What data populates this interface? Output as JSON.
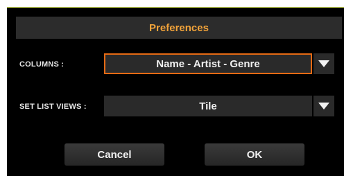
{
  "dialog": {
    "title": "Preferences"
  },
  "columns": {
    "label": "COLUMNS :",
    "value": "Name - Artist - Genre",
    "dropdown_icon": "triangle-down-icon"
  },
  "set_list_views": {
    "label": "SET LIST VIEWS :",
    "value": "Tile",
    "dropdown_icon": "triangle-down-icon"
  },
  "buttons": {
    "cancel": "Cancel",
    "ok": "OK"
  },
  "colors": {
    "title_text": "#f2a33a",
    "selection_border": "#e56a14",
    "background": "#000000",
    "control_fill": "#2a2a2a"
  }
}
